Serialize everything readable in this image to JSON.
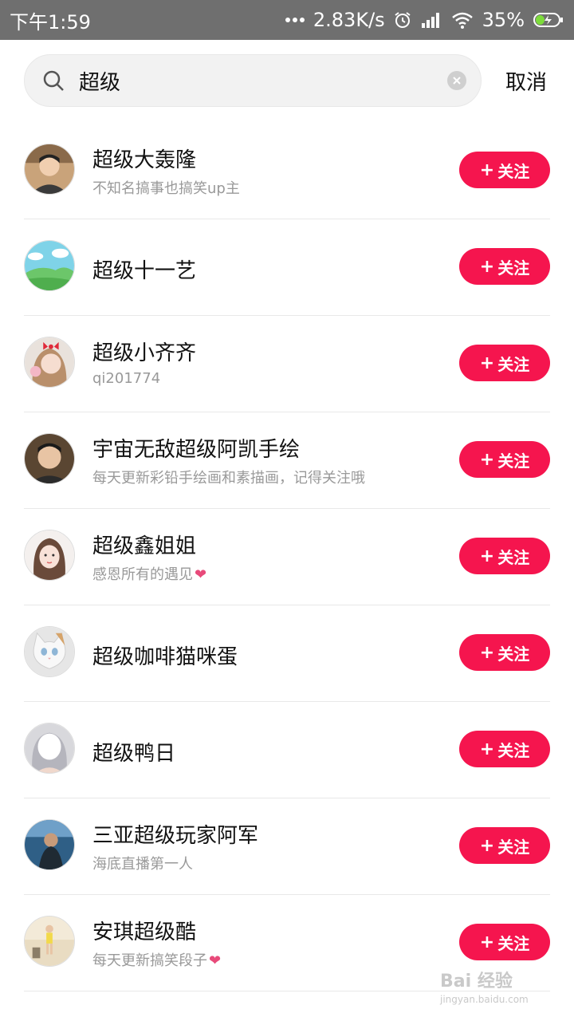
{
  "status_bar": {
    "time": "下午1:59",
    "speed": "2.83K/s",
    "battery": "35%",
    "icons": [
      "dots-icon",
      "alarm-icon",
      "signal-icon",
      "wifi-icon",
      "battery-icon"
    ]
  },
  "search": {
    "value": "超级",
    "cancel_label": "取消",
    "icon": "search-icon"
  },
  "follow_label": "关注",
  "results": [
    {
      "name": "超级大轰隆",
      "bio": "不知名搞事也搞笑up主",
      "heart": ""
    },
    {
      "name": "超级十一艺",
      "bio": "",
      "heart": ""
    },
    {
      "name": "超级小齐齐",
      "bio": "qi201774",
      "heart": ""
    },
    {
      "name": "宇宙无敌超级阿凯手绘",
      "bio": "每天更新彩铅手绘画和素描画，记得关注哦",
      "heart": ""
    },
    {
      "name": "超级鑫姐姐",
      "bio": "感恩所有的遇见",
      "heart": "❤"
    },
    {
      "name": "超级咖啡猫咪蛋",
      "bio": "",
      "heart": ""
    },
    {
      "name": "超级鸭日",
      "bio": "",
      "heart": ""
    },
    {
      "name": "三亚超级玩家阿军",
      "bio": "海底直播第一人",
      "heart": ""
    },
    {
      "name": "安琪超级酷",
      "bio": "每天更新搞笑段子",
      "heart": "❤"
    }
  ],
  "watermark": {
    "main": "Bai 经验",
    "sub": "jingyan.baidu.com"
  },
  "colors": {
    "accent": "#f5154e",
    "status_bar": "#6f6f6f",
    "secondary_text": "#999999"
  }
}
